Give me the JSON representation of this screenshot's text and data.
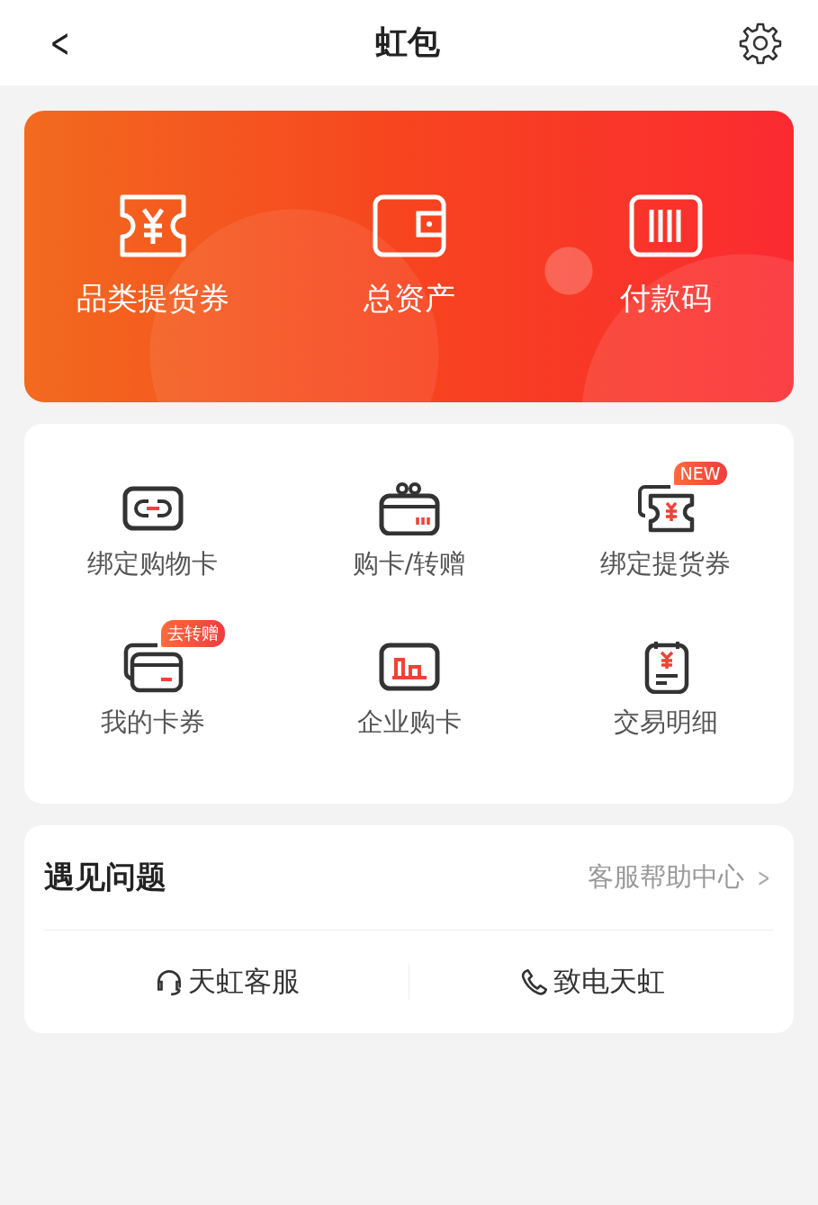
{
  "header": {
    "back": "<",
    "title": "虹包"
  },
  "banner": {
    "items": [
      {
        "kind": "ticket",
        "label": "品类提货券"
      },
      {
        "kind": "wallet",
        "label": "总资产"
      },
      {
        "kind": "barcode",
        "label": "付款码"
      }
    ]
  },
  "services": [
    {
      "kind": "link-card",
      "label": "绑定购物卡"
    },
    {
      "kind": "gift-card",
      "label": "购卡/转赠"
    },
    {
      "kind": "ticket-stack",
      "label": "绑定提货券",
      "badge": "NEW"
    },
    {
      "kind": "cards",
      "label": "我的卡券",
      "badge": "去转赠"
    },
    {
      "kind": "chart-card",
      "label": "企业购卡"
    },
    {
      "kind": "receipt",
      "label": "交易明细"
    }
  ],
  "help": {
    "title": "遇见问题",
    "link": "客服帮助中心",
    "chevron": ">",
    "actions": [
      {
        "kind": "headset",
        "label": "天虹客服"
      },
      {
        "kind": "phone",
        "label": "致电天虹"
      }
    ]
  }
}
